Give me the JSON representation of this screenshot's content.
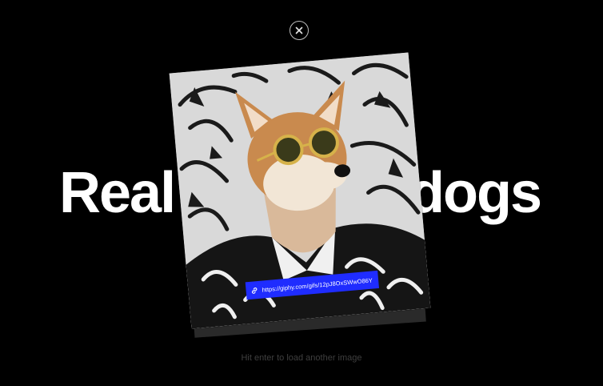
{
  "headline": {
    "left_text": "Real",
    "right_text": "dogs"
  },
  "card": {
    "url": "https://giphy.com/gifs/12pJ8OxSWwO86Y"
  },
  "hint": "Hit enter to load another image",
  "icons": {
    "close": "close-icon",
    "link": "link-icon"
  },
  "colors": {
    "background": "#000000",
    "url_pill": "#1f2cff",
    "headline": "#ffffff"
  }
}
